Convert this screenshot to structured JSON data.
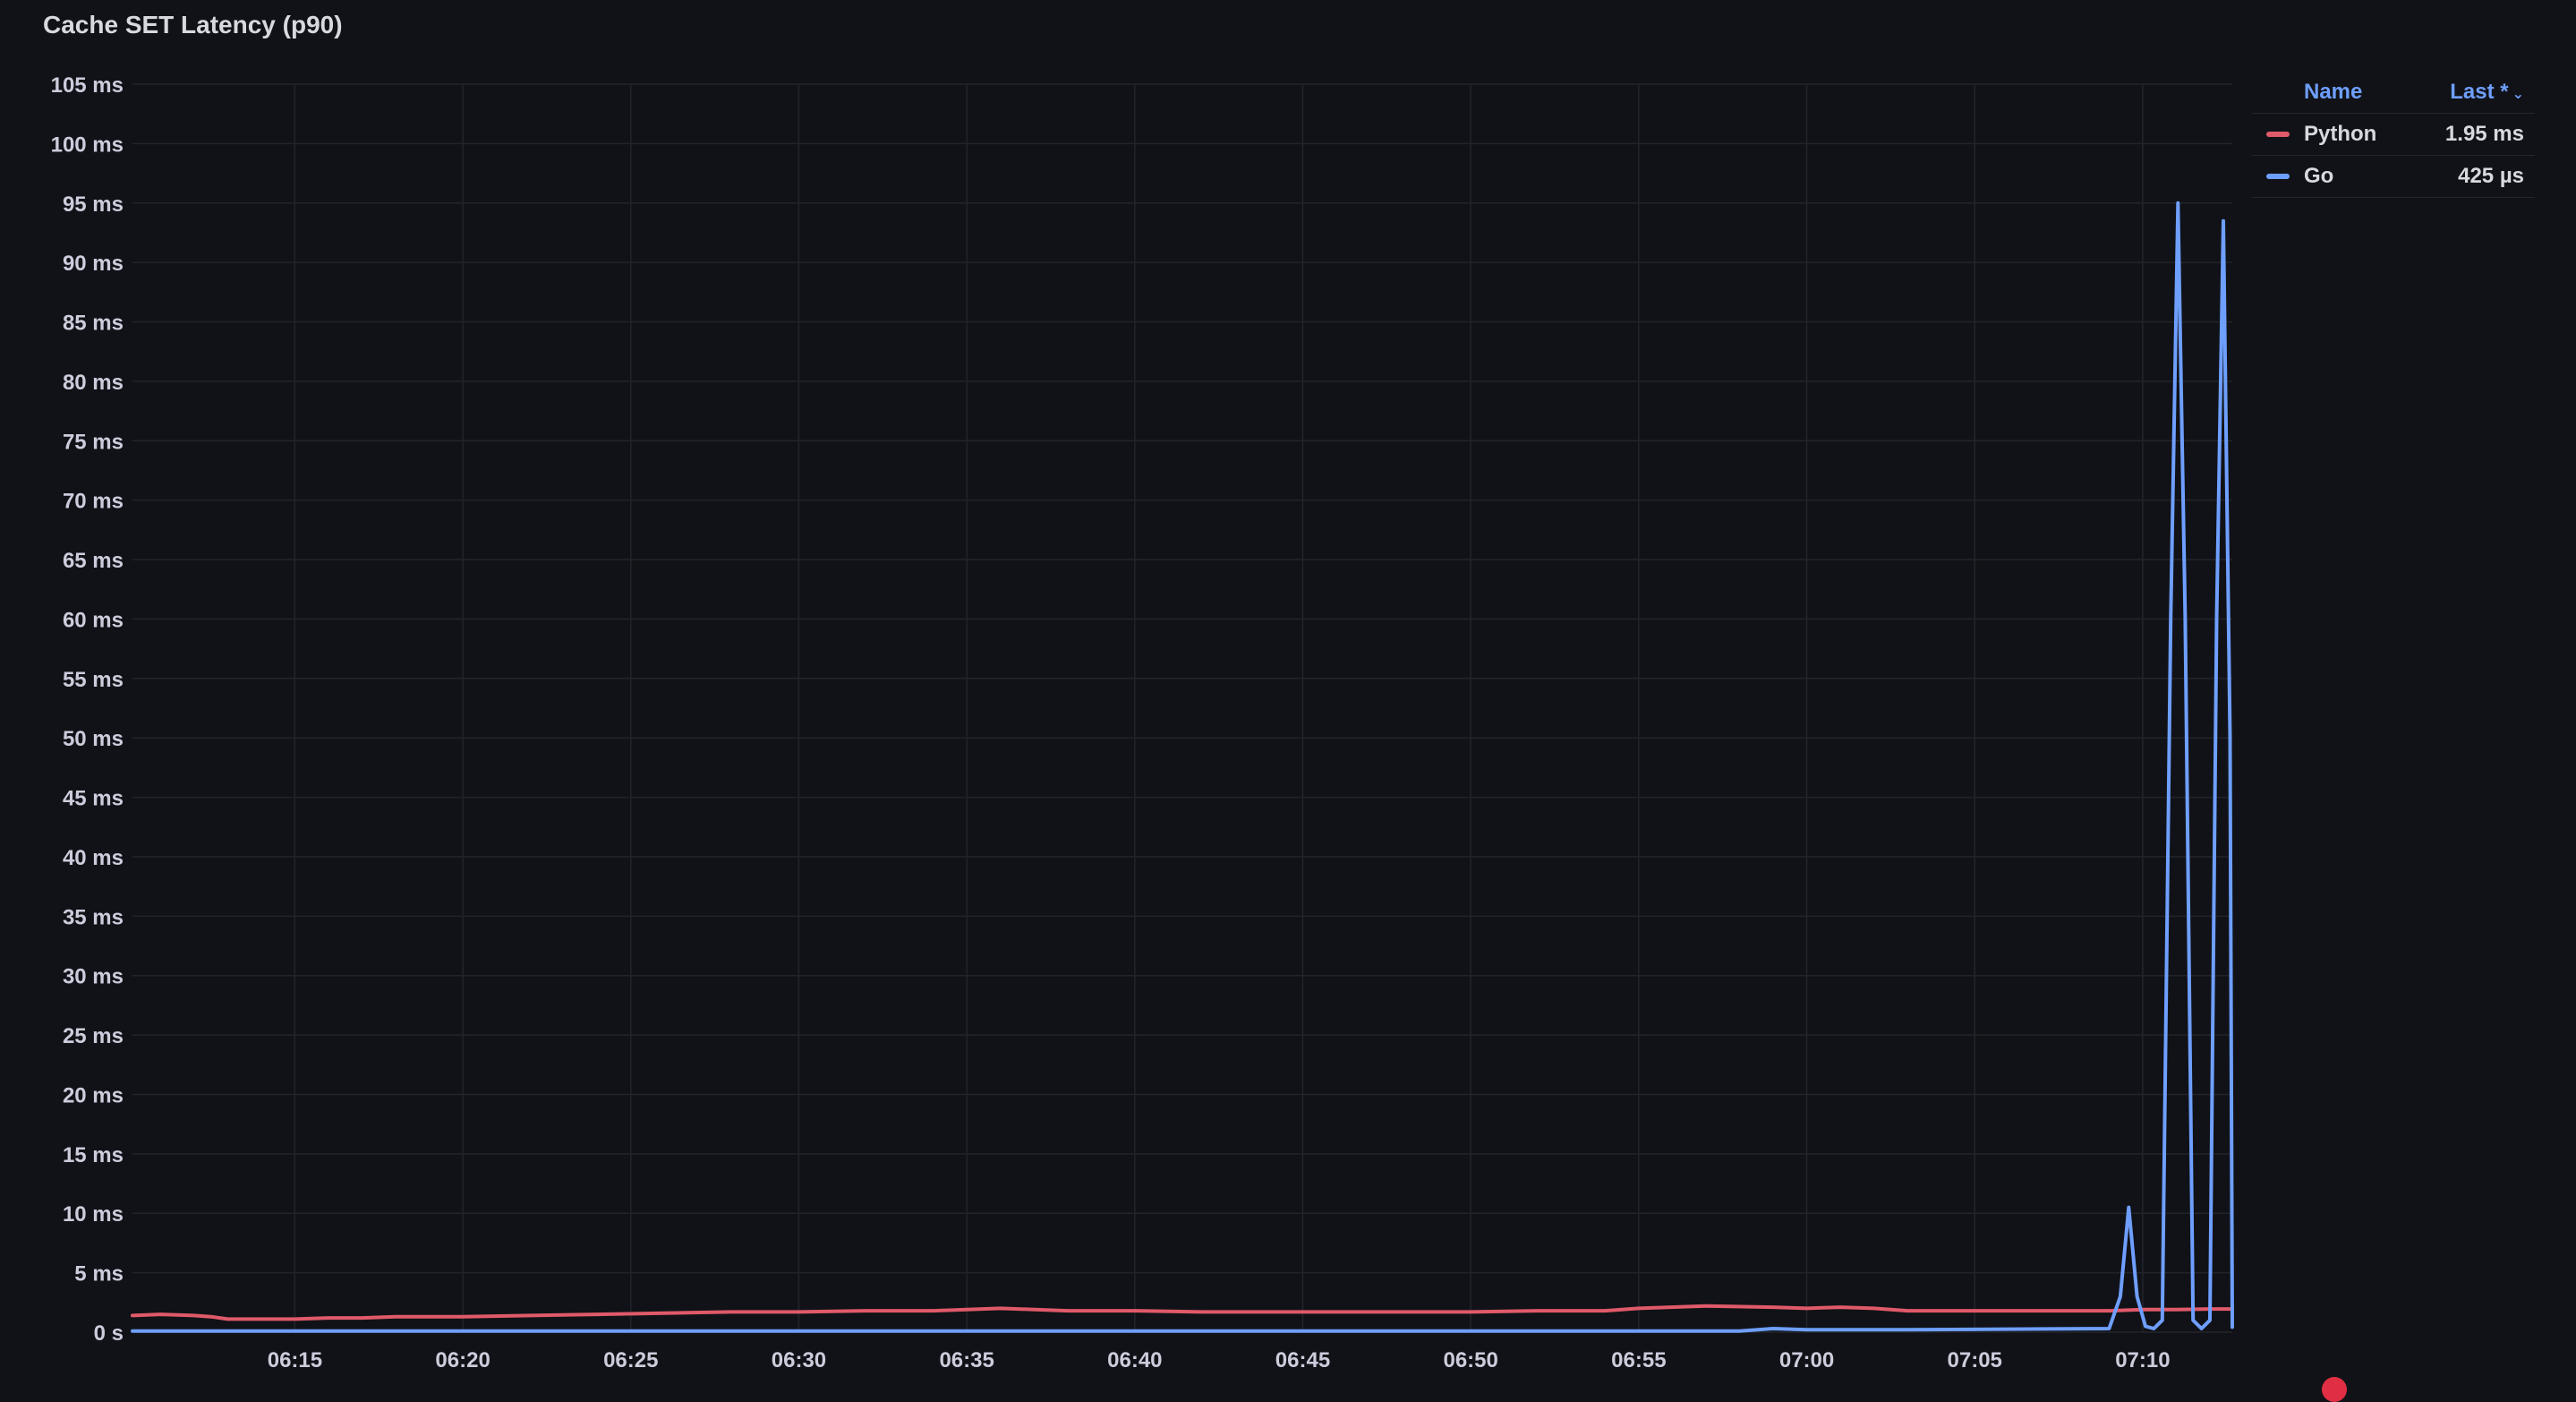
{
  "panel": {
    "title": "Cache SET Latency (p90)"
  },
  "legend": {
    "name_header": "Name",
    "last_header": "Last *",
    "caret": "⌄",
    "rows": [
      {
        "label": "Python",
        "value": "1.95 ms",
        "color": "#e05a6a"
      },
      {
        "label": "Go",
        "value": "425 µs",
        "color": "#6e9fff"
      }
    ]
  },
  "chart_data": {
    "type": "line",
    "xlim": [
      "06:10:10",
      "07:12:40"
    ],
    "ylim": [
      0,
      105
    ],
    "y_unit": "ms",
    "y_ticks": [
      0,
      5,
      10,
      15,
      20,
      25,
      30,
      35,
      40,
      45,
      50,
      55,
      60,
      65,
      70,
      75,
      80,
      85,
      90,
      95,
      100,
      105
    ],
    "y_tick_labels": [
      "0 s",
      "5 ms",
      "10 ms",
      "15 ms",
      "20 ms",
      "25 ms",
      "30 ms",
      "35 ms",
      "40 ms",
      "45 ms",
      "50 ms",
      "55 ms",
      "60 ms",
      "65 ms",
      "70 ms",
      "75 ms",
      "80 ms",
      "85 ms",
      "90 ms",
      "95 ms",
      "100 ms",
      "105 ms"
    ],
    "x_ticks": [
      "06:15",
      "06:20",
      "06:25",
      "06:30",
      "06:35",
      "06:40",
      "06:45",
      "06:50",
      "06:55",
      "07:00",
      "07:05",
      "07:10"
    ],
    "grid": true,
    "series": [
      {
        "name": "Python",
        "color": "#e05a6a",
        "points": [
          [
            "06:10:10",
            1.4
          ],
          [
            "06:11:00",
            1.5
          ],
          [
            "06:12:00",
            1.4
          ],
          [
            "06:12:30",
            1.3
          ],
          [
            "06:13:00",
            1.1
          ],
          [
            "06:14:00",
            1.1
          ],
          [
            "06:15:00",
            1.1
          ],
          [
            "06:16:00",
            1.2
          ],
          [
            "06:17:00",
            1.2
          ],
          [
            "06:18:00",
            1.3
          ],
          [
            "06:19:00",
            1.3
          ],
          [
            "06:20:00",
            1.3
          ],
          [
            "06:22:00",
            1.4
          ],
          [
            "06:24:00",
            1.5
          ],
          [
            "06:26:00",
            1.6
          ],
          [
            "06:28:00",
            1.7
          ],
          [
            "06:30:00",
            1.7
          ],
          [
            "06:32:00",
            1.8
          ],
          [
            "06:34:00",
            1.8
          ],
          [
            "06:36:00",
            2.0
          ],
          [
            "06:38:00",
            1.8
          ],
          [
            "06:40:00",
            1.8
          ],
          [
            "06:42:00",
            1.7
          ],
          [
            "06:44:00",
            1.7
          ],
          [
            "06:46:00",
            1.7
          ],
          [
            "06:48:00",
            1.7
          ],
          [
            "06:50:00",
            1.7
          ],
          [
            "06:52:00",
            1.8
          ],
          [
            "06:54:00",
            1.8
          ],
          [
            "06:55:00",
            2.0
          ],
          [
            "06:57:00",
            2.2
          ],
          [
            "06:59:00",
            2.1
          ],
          [
            "07:00:00",
            2.0
          ],
          [
            "07:01:00",
            2.1
          ],
          [
            "07:02:00",
            2.0
          ],
          [
            "07:03:00",
            1.8
          ],
          [
            "07:05:00",
            1.8
          ],
          [
            "07:07:00",
            1.8
          ],
          [
            "07:09:00",
            1.8
          ],
          [
            "07:10:00",
            1.9
          ],
          [
            "07:11:00",
            1.9
          ],
          [
            "07:12:00",
            1.95
          ],
          [
            "07:12:40",
            1.95
          ]
        ]
      },
      {
        "name": "Go",
        "color": "#6e9fff",
        "points": [
          [
            "06:10:10",
            0.1
          ],
          [
            "06:20:00",
            0.1
          ],
          [
            "06:30:00",
            0.1
          ],
          [
            "06:40:00",
            0.1
          ],
          [
            "06:50:00",
            0.1
          ],
          [
            "06:58:00",
            0.1
          ],
          [
            "06:59:00",
            0.3
          ],
          [
            "07:00:00",
            0.2
          ],
          [
            "07:03:00",
            0.2
          ],
          [
            "07:09:00",
            0.3
          ],
          [
            "07:09:20",
            3.0
          ],
          [
            "07:09:35",
            10.5
          ],
          [
            "07:09:50",
            3.0
          ],
          [
            "07:10:05",
            0.5
          ],
          [
            "07:10:20",
            0.3
          ],
          [
            "07:10:35",
            1.0
          ],
          [
            "07:10:50",
            60.0
          ],
          [
            "07:11:03",
            95.0
          ],
          [
            "07:11:16",
            60.0
          ],
          [
            "07:11:30",
            1.0
          ],
          [
            "07:11:45",
            0.3
          ],
          [
            "07:12:00",
            1.0
          ],
          [
            "07:12:12",
            60.0
          ],
          [
            "07:12:24",
            93.5
          ],
          [
            "07:12:36",
            50.0
          ],
          [
            "07:12:40",
            0.425
          ]
        ]
      }
    ]
  }
}
